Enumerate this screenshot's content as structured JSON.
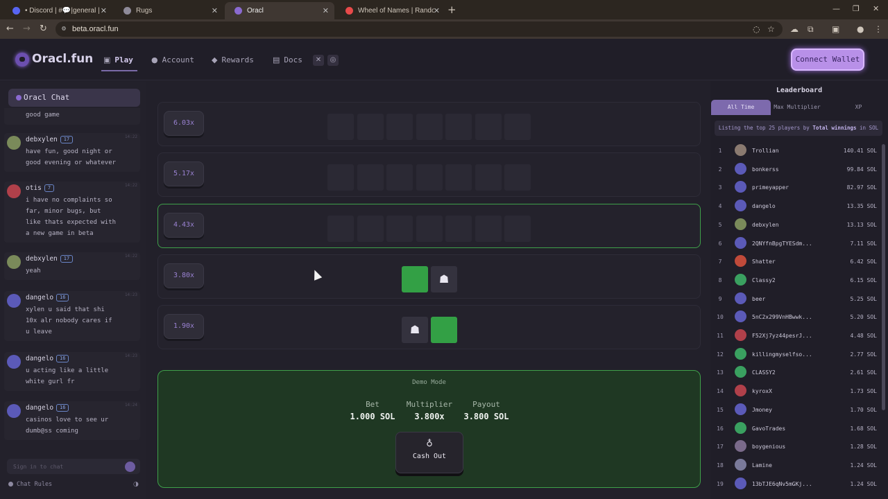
{
  "browser": {
    "tabs": [
      {
        "title": "• Discord | #💬|general | rugs.",
        "favicon": "#5865f2"
      },
      {
        "title": "Rugs",
        "favicon": "#8e8a99"
      },
      {
        "title": "Oracl",
        "favicon": "#8a6ad0"
      },
      {
        "title": "Wheel of Names | Random nam",
        "favicon": "#e84a4a"
      }
    ],
    "url": "beta.oracl.fun"
  },
  "header": {
    "logo": "Oracl.fun",
    "nav": [
      {
        "label": "Play",
        "icon": "gamepad-icon"
      },
      {
        "label": "Account",
        "icon": "user-icon"
      },
      {
        "label": "Rewards",
        "icon": "gift-icon"
      },
      {
        "label": "Docs",
        "icon": "doc-icon"
      }
    ],
    "connect": "Connect Wallet"
  },
  "chat": {
    "title": "Oracl Chat",
    "messages": [
      {
        "user": "",
        "level": "",
        "time": "",
        "text": "good game",
        "avatar": ""
      },
      {
        "user": "debxylen",
        "level": "17",
        "time": "14:22",
        "text": "have fun, good night or\ngood evening or whatever",
        "avatar": "#7a8a5a"
      },
      {
        "user": "otis",
        "level": "7",
        "time": "14:22",
        "text": "i have no complaints so\nfar, minor bugs, but\nlike thats expected with\na new game in beta",
        "avatar": "#b0404a"
      },
      {
        "user": "debxylen",
        "level": "17",
        "time": "14:22",
        "text": "yeah",
        "avatar": "#7a8a5a"
      },
      {
        "user": "dangelo",
        "level": "16",
        "time": "14:23",
        "text": "xylen u said that shi\n10x alr nobody cares if\nu leave",
        "avatar": "#5b5ab8"
      },
      {
        "user": "dangelo",
        "level": "16",
        "time": "14:23",
        "text": "u acting like a little\nwhite gurl fr",
        "avatar": "#5b5ab8"
      },
      {
        "user": "dangelo",
        "level": "16",
        "time": "14:24",
        "text": "casinos love to see ur\ndumb@ss coming",
        "avatar": "#5b5ab8"
      }
    ],
    "input_placeholder": "Sign in to chat",
    "rules": "Chat Rules"
  },
  "game": {
    "rows": [
      {
        "multiplier": "6.03x",
        "tiles": [
          "empty",
          "empty",
          "empty",
          "empty",
          "empty",
          "empty",
          "empty"
        ]
      },
      {
        "multiplier": "5.17x",
        "tiles": [
          "empty",
          "empty",
          "empty",
          "empty",
          "empty",
          "empty",
          "empty"
        ]
      },
      {
        "multiplier": "4.43x",
        "tiles": [
          "empty",
          "empty",
          "empty",
          "empty",
          "empty",
          "empty",
          "empty"
        ]
      },
      {
        "multiplier": "3.80x",
        "tiles": [
          "green",
          "ghost"
        ]
      },
      {
        "multiplier": "1.90x",
        "tiles": [
          "ghost",
          "green"
        ]
      }
    ],
    "active_row": 2,
    "demo": {
      "title": "Demo Mode",
      "bet_label": "Bet",
      "bet_value": "1.000 SOL",
      "multiplier_label": "Multiplier",
      "multiplier_value": "3.800x",
      "payout_label": "Payout",
      "payout_value": "3.800 SOL",
      "cashout_label": "Cash Out"
    }
  },
  "leaderboard": {
    "title": "Leaderboard",
    "tabs": [
      "All Time",
      "Max Multiplier",
      "XP"
    ],
    "subtitle_prefix": "Listing the top 25 players by",
    "subtitle_bold": "Total winnings",
    "subtitle_suffix": "in SOL",
    "rows": [
      {
        "rank": "1",
        "name": "Trollian",
        "value": "140.41 SOL",
        "avatar": "#8a7a70"
      },
      {
        "rank": "2",
        "name": "bonkerss",
        "value": "99.84 SOL",
        "avatar": "#5b5ab8"
      },
      {
        "rank": "3",
        "name": "primeyapper",
        "value": "82.97 SOL",
        "avatar": "#5b5ab8"
      },
      {
        "rank": "4",
        "name": "dangelo",
        "value": "13.35 SOL",
        "avatar": "#5b5ab8"
      },
      {
        "rank": "5",
        "name": "debxylen",
        "value": "13.13 SOL",
        "avatar": "#7a8a5a"
      },
      {
        "rank": "6",
        "name": "2QNYfnBpgTYESdm...",
        "value": "7.11 SOL",
        "avatar": "#5b5ab8"
      },
      {
        "rank": "7",
        "name": "Shatter",
        "value": "6.42 SOL",
        "avatar": "#c04a3a"
      },
      {
        "rank": "8",
        "name": "Classy2",
        "value": "6.15 SOL",
        "avatar": "#3aa060"
      },
      {
        "rank": "9",
        "name": "beer",
        "value": "5.25 SOL",
        "avatar": "#5b5ab8"
      },
      {
        "rank": "10",
        "name": "5nC2x299VnHBwwk...",
        "value": "5.20 SOL",
        "avatar": "#5b5ab8"
      },
      {
        "rank": "11",
        "name": "F52Xj7yz44pesrJ...",
        "value": "4.48 SOL",
        "avatar": "#b0404a"
      },
      {
        "rank": "12",
        "name": "killingmyselfso...",
        "value": "2.77 SOL",
        "avatar": "#3aa060"
      },
      {
        "rank": "13",
        "name": "CLASSY2",
        "value": "2.61 SOL",
        "avatar": "#3aa060"
      },
      {
        "rank": "14",
        "name": "kyroxX",
        "value": "1.73 SOL",
        "avatar": "#b0404a"
      },
      {
        "rank": "15",
        "name": "Jmoney",
        "value": "1.70 SOL",
        "avatar": "#5b5ab8"
      },
      {
        "rank": "16",
        "name": "GavoTrades",
        "value": "1.68 SOL",
        "avatar": "#3aa060"
      },
      {
        "rank": "17",
        "name": "boygenious",
        "value": "1.28 SOL",
        "avatar": "#7a6a8a"
      },
      {
        "rank": "18",
        "name": "Lamine",
        "value": "1.24 SOL",
        "avatar": "#7a7a9a"
      },
      {
        "rank": "19",
        "name": "13bTJE6qNv5mGKj...",
        "value": "1.24 SOL",
        "avatar": "#5b5ab8"
      }
    ]
  }
}
